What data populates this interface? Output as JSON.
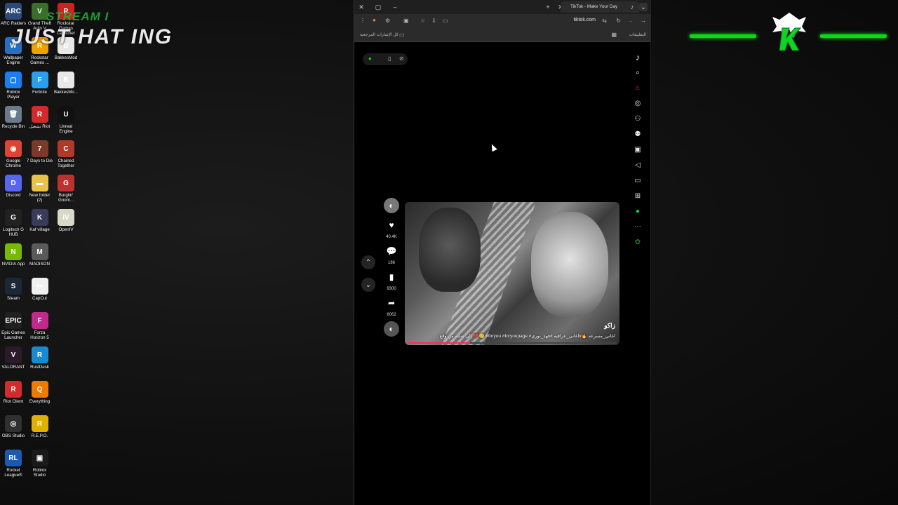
{
  "stream": {
    "subtitle": "STREAM I",
    "title": "JUST HAT ING"
  },
  "desktop_icons": [
    {
      "label": "ARC Raiders",
      "color": "#2b4a7a",
      "glyph": "ARC",
      "col": 0,
      "row": 0
    },
    {
      "label": "Grand Theft Auto V",
      "color": "#3b6e2a",
      "glyph": "V",
      "col": 1,
      "row": 0
    },
    {
      "label": "Rockstar Games Launcher",
      "color": "#cc2222",
      "glyph": "R",
      "col": 2,
      "row": 0
    },
    {
      "label": "Wallpaper Engine",
      "color": "#2a6fbf",
      "glyph": "W",
      "col": 0,
      "row": 1
    },
    {
      "label": "Rockstar Games ...",
      "color": "#f0a000",
      "glyph": "R",
      "col": 1,
      "row": 1
    },
    {
      "label": "BakkesMod",
      "color": "#e8e8e8",
      "glyph": "B",
      "col": 2,
      "row": 1
    },
    {
      "label": "Roblox Player",
      "color": "#1a7df0",
      "glyph": "▢",
      "col": 0,
      "row": 2
    },
    {
      "label": "Fortnite",
      "color": "#2a9ff0",
      "glyph": "F",
      "col": 1,
      "row": 2
    },
    {
      "label": "BakkesMo...",
      "color": "#e8e8e8",
      "glyph": "B",
      "col": 2,
      "row": 2
    },
    {
      "label": "Recycle Bin",
      "color": "#6a7a8a",
      "glyph": "🗑",
      "col": 0,
      "row": 3
    },
    {
      "label": "تشغيل Riot",
      "color": "#d22b2b",
      "glyph": "R",
      "col": 1,
      "row": 3
    },
    {
      "label": "Unreal Engine",
      "color": "#101010",
      "glyph": "U",
      "col": 2,
      "row": 3
    },
    {
      "label": "Google Chrome",
      "color": "#dd4433",
      "glyph": "◉",
      "col": 0,
      "row": 4
    },
    {
      "label": "7 Days to Die",
      "color": "#7a3a2a",
      "glyph": "7",
      "col": 1,
      "row": 4
    },
    {
      "label": "Chained Together",
      "color": "#b03a2a",
      "glyph": "C",
      "col": 2,
      "row": 4
    },
    {
      "label": "Discord",
      "color": "#5865f2",
      "glyph": "D",
      "col": 0,
      "row": 5
    },
    {
      "label": "New folder (2)",
      "color": "#e8c24a",
      "glyph": "▬",
      "col": 1,
      "row": 5
    },
    {
      "label": "Burglin' Gnom...",
      "color": "#c03030",
      "glyph": "G",
      "col": 2,
      "row": 5
    },
    {
      "label": "Logitech G HUB",
      "color": "#222222",
      "glyph": "G",
      "col": 0,
      "row": 6
    },
    {
      "label": "Kaf village",
      "color": "#3a3a5a",
      "glyph": "K",
      "col": 1,
      "row": 6
    },
    {
      "label": "OpenIV",
      "color": "#d8d8c8",
      "glyph": "IV",
      "col": 2,
      "row": 6
    },
    {
      "label": "NVIDIA App",
      "color": "#76b900",
      "glyph": "N",
      "col": 0,
      "row": 7
    },
    {
      "label": "MADISON",
      "color": "#5a5a5a",
      "glyph": "M",
      "col": 1,
      "row": 7
    },
    {
      "label": "Steam",
      "color": "#1b2838",
      "glyph": "S",
      "col": 0,
      "row": 8
    },
    {
      "label": "CapCut",
      "color": "#f0f0f0",
      "glyph": "✂",
      "col": 1,
      "row": 8
    },
    {
      "label": "Epic Games Launcher",
      "color": "#202020",
      "glyph": "EPIC",
      "col": 0,
      "row": 9
    },
    {
      "label": "Forza Horizon 5",
      "color": "#c02a8a",
      "glyph": "F",
      "col": 1,
      "row": 9
    },
    {
      "label": "VALORANT",
      "color": "#2a1a2a",
      "glyph": "V",
      "col": 0,
      "row": 10
    },
    {
      "label": "RustDesk",
      "color": "#1a8ad0",
      "glyph": "R",
      "col": 1,
      "row": 10
    },
    {
      "label": "Riot Client",
      "color": "#d22b2b",
      "glyph": "R",
      "col": 0,
      "row": 11
    },
    {
      "label": "Everything",
      "color": "#f07a00",
      "glyph": "Q",
      "col": 1,
      "row": 11
    },
    {
      "label": "OBS Studio",
      "color": "#303030",
      "glyph": "◎",
      "col": 0,
      "row": 12
    },
    {
      "label": "R.E.P.O.",
      "color": "#e0b000",
      "glyph": "R",
      "col": 1,
      "row": 12
    },
    {
      "label": "Rocket League®",
      "color": "#1a5ab0",
      "glyph": "RL",
      "col": 0,
      "row": 13
    },
    {
      "label": "Roblox Studio",
      "color": "#1a1a1a",
      "glyph": "▣",
      "col": 1,
      "row": 13
    }
  ],
  "browser": {
    "tab_title": "TikTok - Make Your Day",
    "url": "tiktok.com",
    "bookmarks_all": "كل الإشارات المرجعية",
    "bookmarks_apps": "التطبيقات"
  },
  "video": {
    "tag": "زاكو",
    "caption": "إلي شلته من وقع 💔🥲 #foryou #foryoupage #اغاني_مسرعه 🔥#اغاني_عراقيه #فهد_نوري",
    "progress": 0.3
  },
  "actions": {
    "likes": "40.4K",
    "comments": "186",
    "saves": "9300",
    "shares": "6062"
  },
  "colors": {
    "accent_green": "#11d420",
    "tiktok_red": "#fe2c55"
  }
}
